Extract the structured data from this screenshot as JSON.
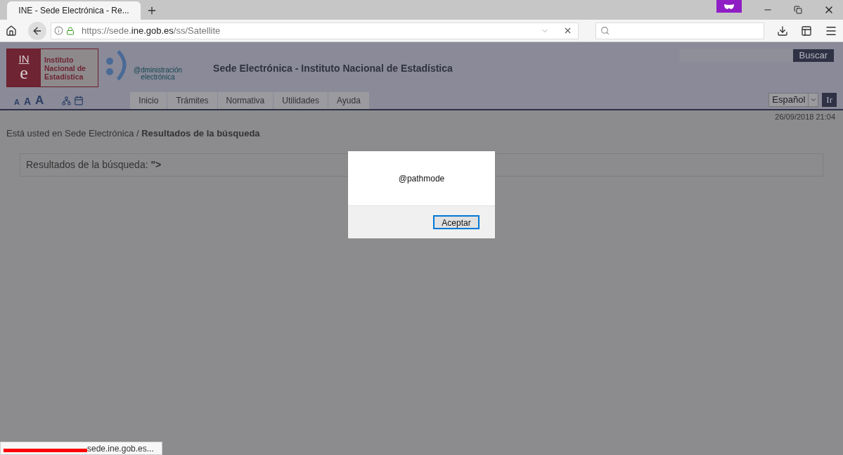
{
  "browser": {
    "tab": {
      "title": "INE - Sede Electrónica - Re...",
      "selected": true
    },
    "url": {
      "scheme": "https://sede.",
      "host": "ine.gob.es",
      "path": "/ss/Satellite"
    }
  },
  "header": {
    "logo": {
      "mark_top": "IN",
      "mark_bottom": "e",
      "lines": [
        "Instituto",
        "Nacional de",
        "Estadística"
      ]
    },
    "admin_logo": [
      "@dministración",
      "electrónica"
    ],
    "title": "Sede Electrónica - Instituto Nacional de Estadística",
    "search_button": "Buscar",
    "font_sizes": [
      "A",
      "A",
      "A"
    ],
    "nav": [
      {
        "label": "Inicio",
        "selected": false
      },
      {
        "label": "Trámites",
        "selected": false
      },
      {
        "label": "Normativa",
        "selected": false
      },
      {
        "label": "Utilidades",
        "selected": false
      },
      {
        "label": "Ayuda",
        "selected": false
      }
    ],
    "language": "Español",
    "go_button": "Ir"
  },
  "datetime": "26/09/2018 21:04",
  "breadcrumb": {
    "prefix": "Está usted en Sede Electrónica / ",
    "current": "Resultados de la búsqueda"
  },
  "results": "Resultados de la búsqueda: **\">**",
  "dialog": {
    "message": "@pathmode",
    "button": "Aceptar"
  },
  "status_bar": "sede.ine.gob.es..."
}
